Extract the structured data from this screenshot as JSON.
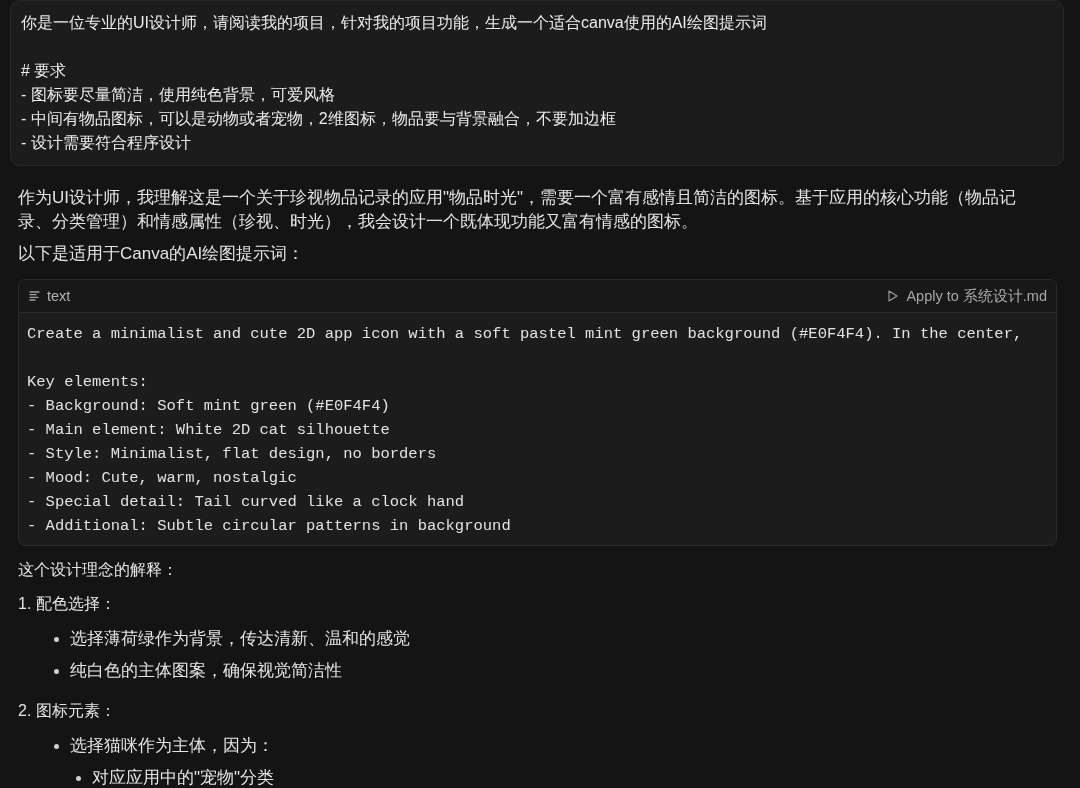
{
  "user_message": {
    "intro": "你是一位专业的UI设计师，请阅读我的项目，针对我的项目功能，生成一个适合canva使用的AI绘图提示词",
    "heading": "# 要求",
    "items": [
      "- 图标要尽量简洁，使用纯色背景，可爱风格",
      "- 中间有物品图标，可以是动物或者宠物，2维图标，物品要与背景融合，不要加边框",
      "- 设计需要符合程序设计"
    ]
  },
  "response": {
    "paragraphs": [
      "作为UI设计师，我理解这是一个关于珍视物品记录的应用\"物品时光\"，需要一个富有感情且简洁的图标。基于应用的核心功能（物品记录、分类管理）和情感属性（珍视、时光），我会设计一个既体现功能又富有情感的图标。",
      "以下是适用于Canva的AI绘图提示词："
    ],
    "code_block": {
      "language": "text",
      "action": "Apply to 系统设计.md",
      "line_groups": [
        [
          "Create a minimalist and cute 2D app icon with a soft pastel mint green background (#E0F4F4). In the center,"
        ],
        [
          "Key elements:",
          "- Background: Soft mint green (#E0F4F4)",
          "- Main element: White 2D cat silhouette",
          "- Style: Minimalist, flat design, no borders",
          "- Mood: Cute, warm, nostalgic",
          "- Special detail: Tail curved like a clock hand",
          "- Additional: Subtle circular patterns in background"
        ]
      ]
    },
    "explanation_title": "这个设计理念的解释：",
    "sections": [
      {
        "title": "1. 配色选择：",
        "bullets": [
          {
            "text": "选择薄荷绿作为背景，传达清新、温和的感觉"
          },
          {
            "text": "纯白色的主体图案，确保视觉简洁性"
          }
        ]
      },
      {
        "title": "2. 图标元素：",
        "bullets": [
          {
            "text": "选择猫咪作为主体，因为：",
            "children": [
              {
                "text": "对应应用中的\"宠物\"分类"
              }
            ]
          }
        ]
      }
    ]
  }
}
